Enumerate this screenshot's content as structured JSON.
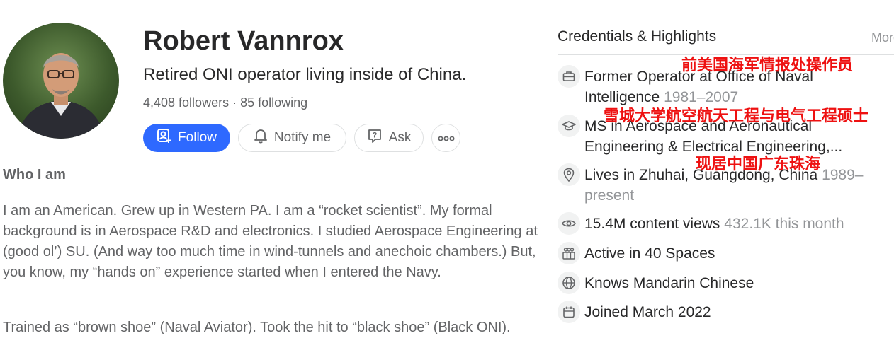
{
  "profile": {
    "name": "Robert Vannrox",
    "tagline": "Retired ONI operator living inside of China.",
    "followers": "4,408 followers",
    "separator": "·",
    "following": "85 following",
    "avatar_icon": "person-portrait-photo"
  },
  "actions": {
    "follow_label": "Follow",
    "notify_label": "Notify me",
    "ask_label": "Ask",
    "more_icon": "ellipsis"
  },
  "about": {
    "heading": "Who I am",
    "paragraphs": [
      "I am an American. Grew up in Western PA. I am a “rocket scientist”. My formal background is in Aerospace R&D and electronics. I studied Aerospace Engineering at (good ol’) SU. (And way too much time in wind-tunnels and anechoic chambers.) But, you know, my “hands on” experience started when I entered the Navy.",
      "Trained as “brown shoe” (Naval Aviator). Took the hit to “black shoe” (Black ONI)."
    ]
  },
  "credentials": {
    "title": "Credentials & Highlights",
    "more": "More",
    "items": [
      {
        "icon": "briefcase-icon",
        "text": "Former Operator at Office of Naval Intelligence",
        "sub": "1981–2007"
      },
      {
        "icon": "graduation-cap-icon",
        "text": "MS in Aerospace and Aeronautical Engineering & Electrical Engineering,...",
        "sub": ""
      },
      {
        "icon": "location-pin-icon",
        "text": "Lives in Zhuhai, Guangdong, China",
        "sub": "1989–present"
      },
      {
        "icon": "eye-icon",
        "text": "15.4M content views",
        "sub": "432.1K this month"
      },
      {
        "icon": "spaces-icon",
        "text": "Active in 40 Spaces",
        "sub": ""
      },
      {
        "icon": "globe-icon",
        "text": "Knows Mandarin Chinese",
        "sub": ""
      },
      {
        "icon": "calendar-icon",
        "text": "Joined March 2022",
        "sub": ""
      }
    ]
  },
  "annotations": [
    "前美国海军情报处操作员",
    "雪城大学航空航天工程与电气工程硕士",
    "现居中国广东珠海"
  ],
  "colors": {
    "accent": "#2e69ff",
    "text": "#282829",
    "muted": "#636466",
    "annotation": "#ee1111"
  }
}
